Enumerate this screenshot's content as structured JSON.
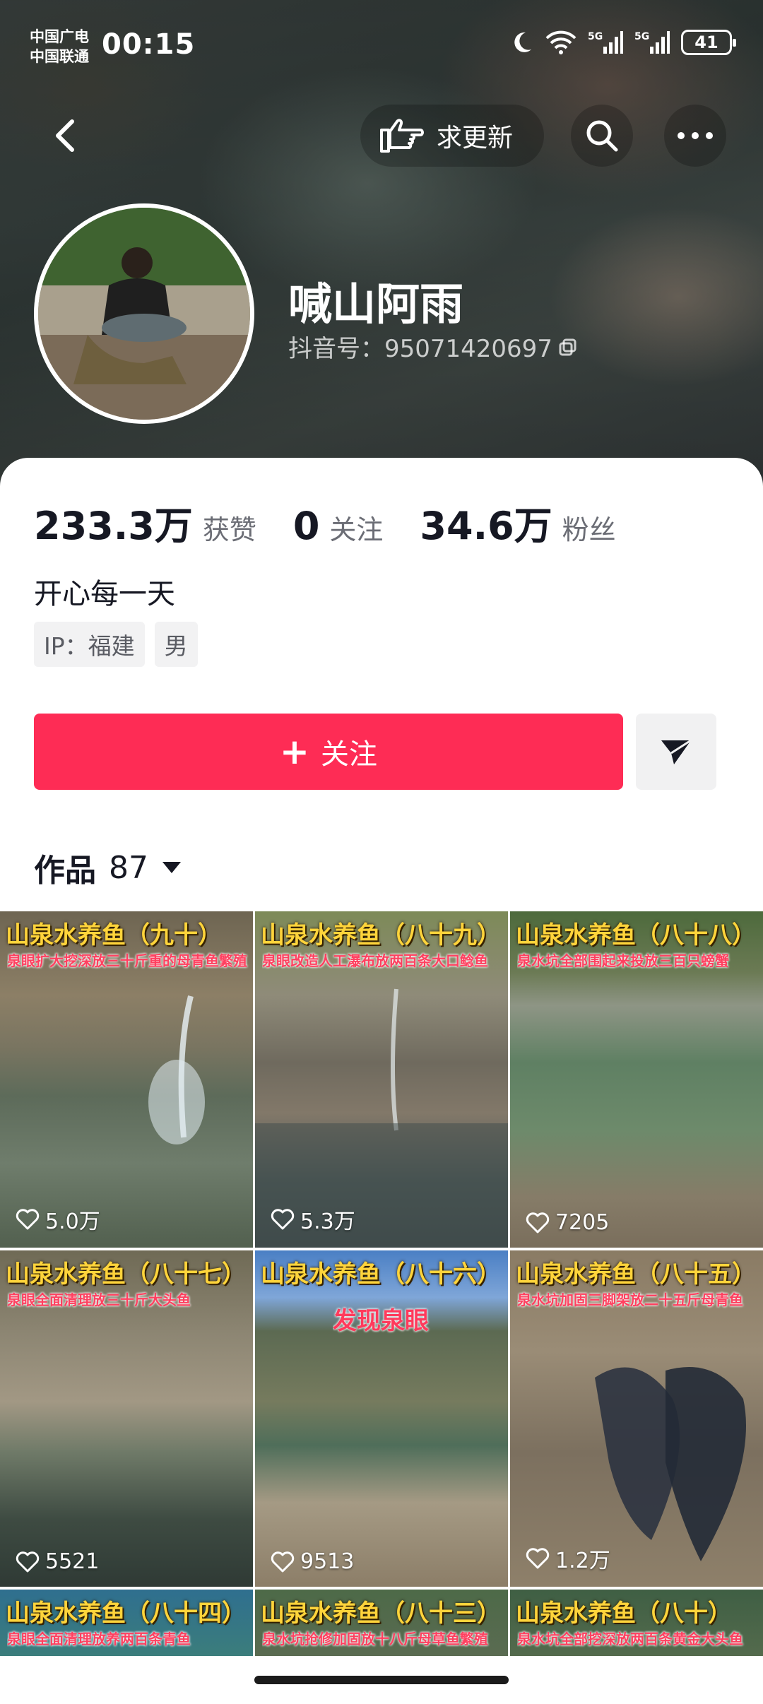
{
  "status_bar": {
    "carrier1": "中国广电",
    "carrier2": "中国联通",
    "time": "00:15",
    "battery": "41"
  },
  "nav": {
    "request_update_label": "求更新"
  },
  "profile": {
    "name": "喊山阿雨",
    "douyin_id": "抖音号：95071420697",
    "stats": [
      {
        "value": "233.3万",
        "label": "获赞"
      },
      {
        "value": "0",
        "label": "关注"
      },
      {
        "value": "34.6万",
        "label": "粉丝"
      }
    ],
    "bio": "开心每一天",
    "tags": [
      "IP：福建",
      "男"
    ]
  },
  "actions": {
    "follow_label": "关注"
  },
  "works": {
    "label": "作品",
    "count": "87"
  },
  "videos": [
    {
      "title": "山泉水养鱼（九十）",
      "subtitle": "泉眼扩大挖深放三十斤重的母青鱼繁殖",
      "likes": "5.0万"
    },
    {
      "title": "山泉水养鱼（八十九）",
      "subtitle": "泉眼改造人工瀑布放两百条大口鲶鱼",
      "likes": "5.3万"
    },
    {
      "title": "山泉水养鱼（八十八）",
      "subtitle": "泉水坑全部围起来投放三百只螃蟹",
      "likes": "7205"
    },
    {
      "title": "山泉水养鱼（八十七）",
      "subtitle": "泉眼全面清理放三十斤大头鱼",
      "likes": "5521"
    },
    {
      "title": "山泉水养鱼（八十六）",
      "subtitle": "发现泉眼",
      "likes": "9513"
    },
    {
      "title": "山泉水养鱼（八十五）",
      "subtitle": "泉水坑加固三脚架放二十五斤母青鱼",
      "likes": "1.2万"
    },
    {
      "title": "山泉水养鱼（八十四）",
      "subtitle": "泉眼全面清理放养两百条青鱼",
      "likes": ""
    },
    {
      "title": "山泉水养鱼（八十三）",
      "subtitle": "泉水坑抢修加固放十八斤母草鱼繁殖",
      "likes": ""
    },
    {
      "title": "山泉水养鱼（八十）",
      "subtitle": "泉水坑全部挖深放两百条黄金大头鱼",
      "likes": ""
    }
  ]
}
